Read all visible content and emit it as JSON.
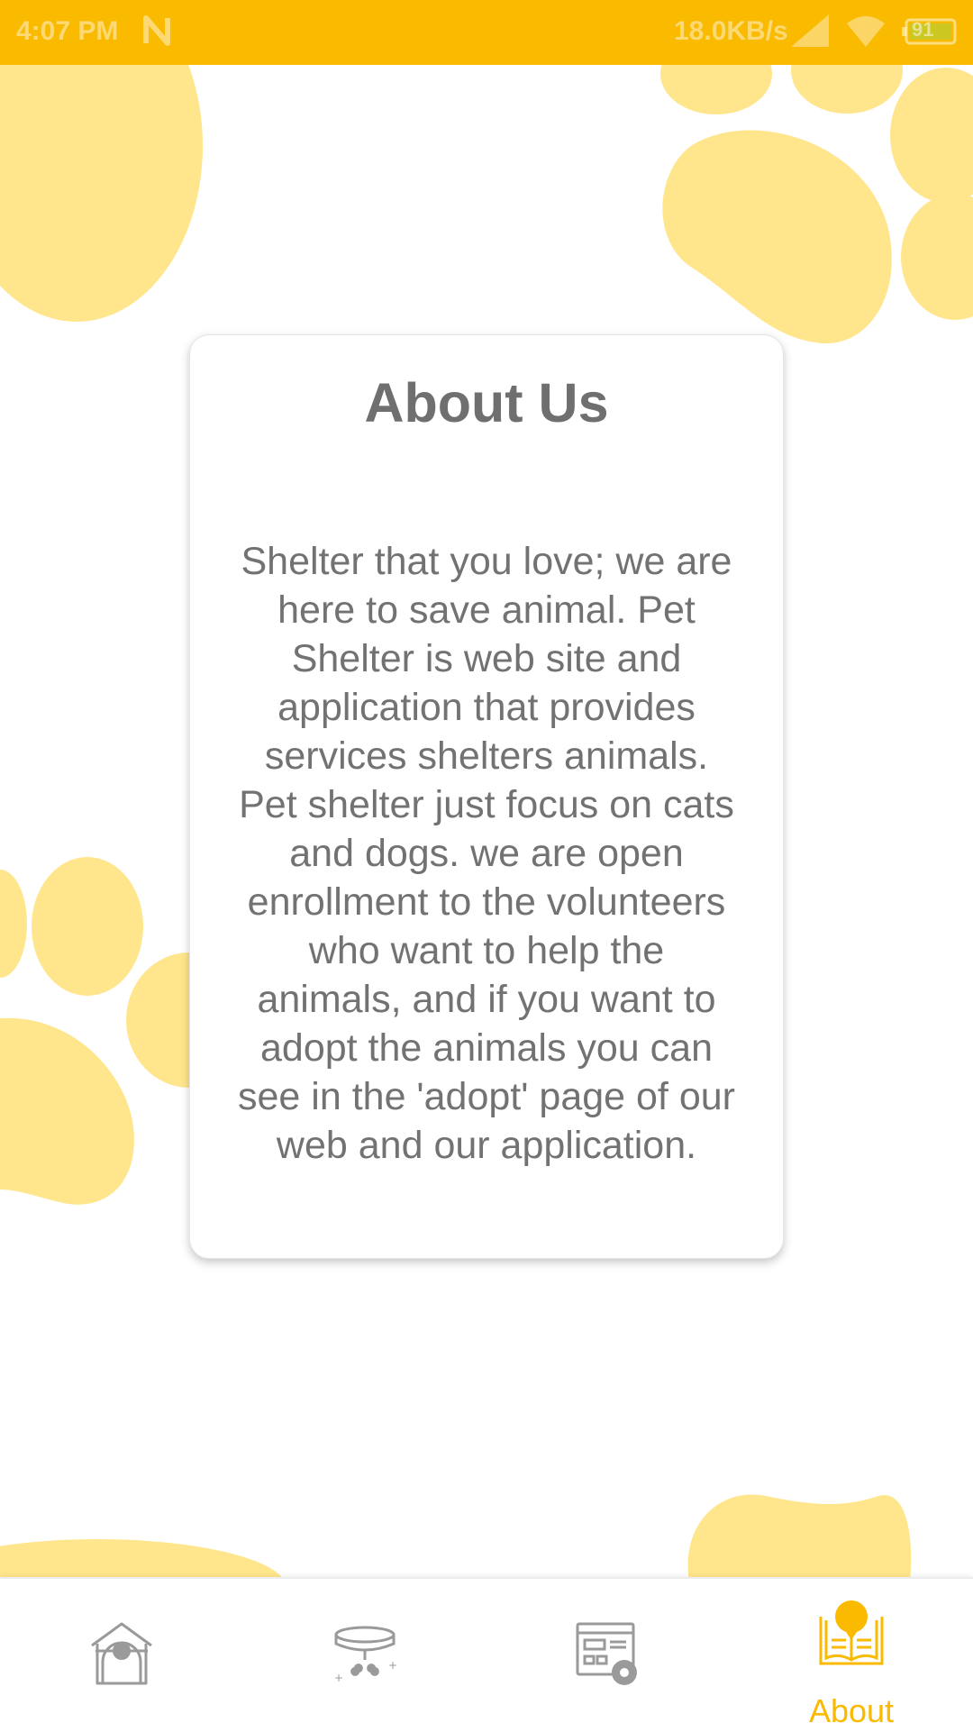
{
  "status_bar": {
    "time": "4:07 PM",
    "network_speed": "18.0KB/s",
    "battery_level": "91"
  },
  "about": {
    "title": "About Us",
    "body": "Shelter that you love; we are here to save animal. Pet Shelter is web site and application that provides services shelters animals. Pet shelter just focus on cats and dogs. we are open enrollment to the volunteers who want to help the animals, and if you want to adopt the animals you can see in the 'adopt' page of our web and our application."
  },
  "bottom_nav": {
    "items": [
      {
        "icon": "dog-house-icon",
        "label": "",
        "active": false
      },
      {
        "icon": "pet-collar-icon",
        "label": "",
        "active": false
      },
      {
        "icon": "web-settings-icon",
        "label": "",
        "active": false
      },
      {
        "icon": "book-info-icon",
        "label": "About",
        "active": true
      }
    ]
  },
  "colors": {
    "accent": "#F9BA00",
    "paw": "#FFE68C",
    "text": "#727272",
    "title": "#6F6F6F",
    "icon_inactive": "#9A9A9A"
  }
}
